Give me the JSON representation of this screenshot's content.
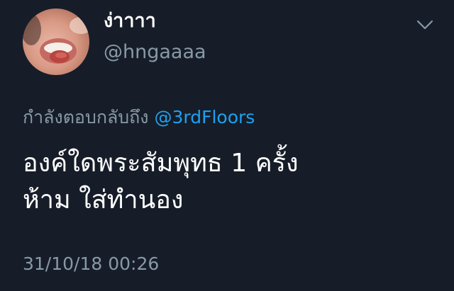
{
  "tweet": {
    "author": {
      "display_name": "ง่าาาา",
      "handle": "@hngaaaa",
      "avatar": "avatar-photo"
    },
    "menu_icon": "chevron-down-icon",
    "reply_prefix": "กำลังตอบกลับถึง",
    "reply_mention": "@3rdFloors",
    "text_lines": [
      "องค์ใดพระสัมพุทธ 1 ครั้ง",
      "ห้าม ใส่ทำนอง"
    ],
    "timestamp": "31/10/18 00:26"
  },
  "colors": {
    "background": "#161d28",
    "primary_text": "#ffffff",
    "secondary_text": "#8899a6",
    "link": "#1da1f2"
  }
}
